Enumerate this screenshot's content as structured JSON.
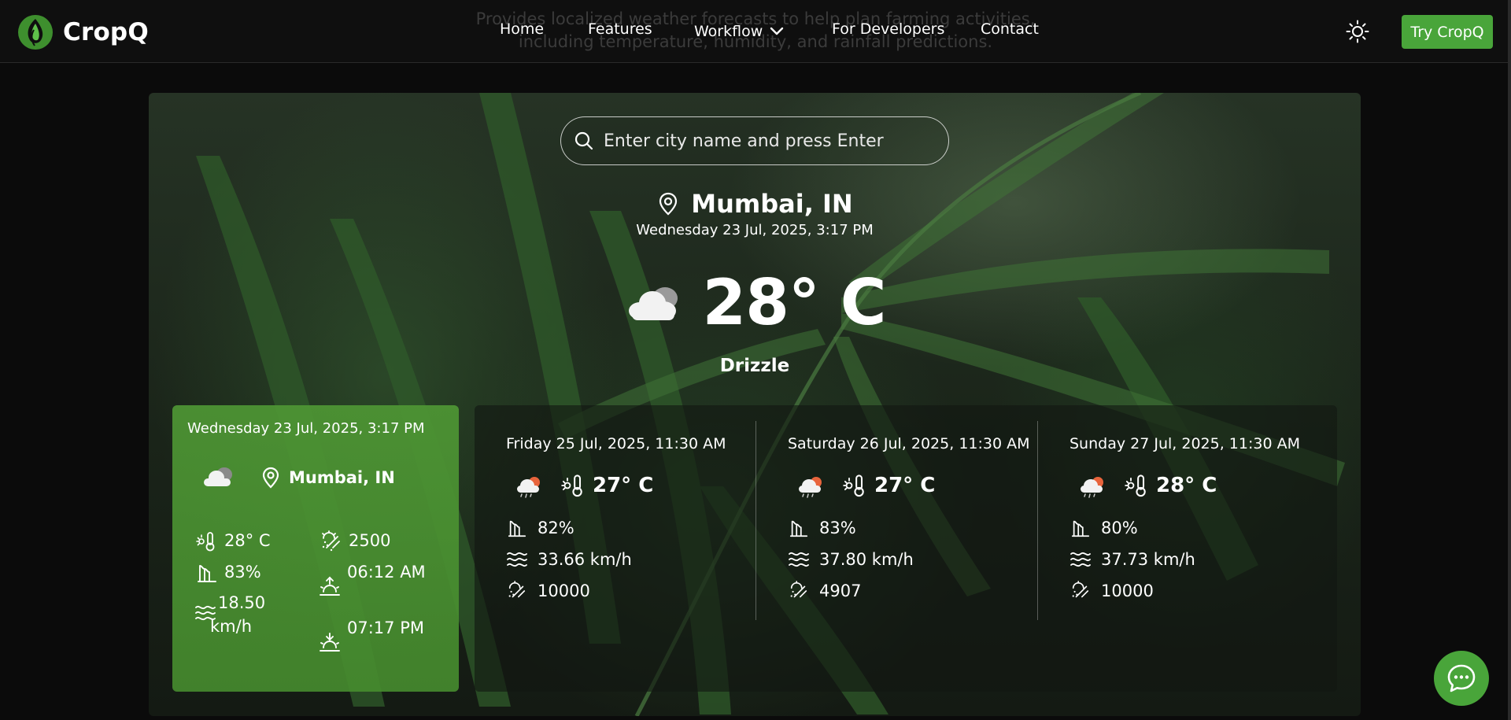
{
  "navbar": {
    "brand": "CropQ",
    "ghost_text": "Provides localized weather forecasts to help plan farming activities, including temperature, humidity, and rainfall predictions.",
    "links": {
      "home": "Home",
      "features": "Features",
      "workflow": "Workflow",
      "developers": "For Developers",
      "contact": "Contact"
    },
    "cta": "Try CropQ",
    "theme_icon": "sun-icon"
  },
  "search": {
    "placeholder": "Enter city name and press Enter",
    "value": ""
  },
  "current": {
    "location": "Mumbai, IN",
    "datetime": "Wednesday 23 Jul, 2025, 3:17 PM",
    "temperature": "28° C",
    "condition": "Drizzle",
    "icon": "cloud-icon"
  },
  "current_card": {
    "datetime": "Wednesday 23 Jul, 2025, 3:17 PM",
    "location": "Mumbai, IN",
    "temperature": "28° C",
    "humidity": "83%",
    "wind_value": "18.50",
    "wind_unit": "km/h",
    "visibility": "2500",
    "sunrise_time": "06:12 AM",
    "sunset_time": "07:17 PM"
  },
  "forecast": [
    {
      "datetime": "Friday 25 Jul, 2025, 11:30 AM",
      "temperature": "27° C",
      "humidity": "82%",
      "wind": "33.66 km/h",
      "visibility": "10000",
      "icon": "cloud-sun-rain-icon"
    },
    {
      "datetime": "Saturday 26 Jul, 2025, 11:30 AM",
      "temperature": "27° C",
      "humidity": "83%",
      "wind": "37.80 km/h",
      "visibility": "4907",
      "icon": "cloud-sun-rain-icon"
    },
    {
      "datetime": "Sunday 27 Jul, 2025, 11:30 AM",
      "temperature": "28° C",
      "humidity": "80%",
      "wind": "37.73 km/h",
      "visibility": "10000",
      "icon": "cloud-sun-rain-icon"
    }
  ],
  "colors": {
    "accent": "#49a53a",
    "card_green": "#4e9634",
    "navbar_bg": "#0f0f0f"
  }
}
